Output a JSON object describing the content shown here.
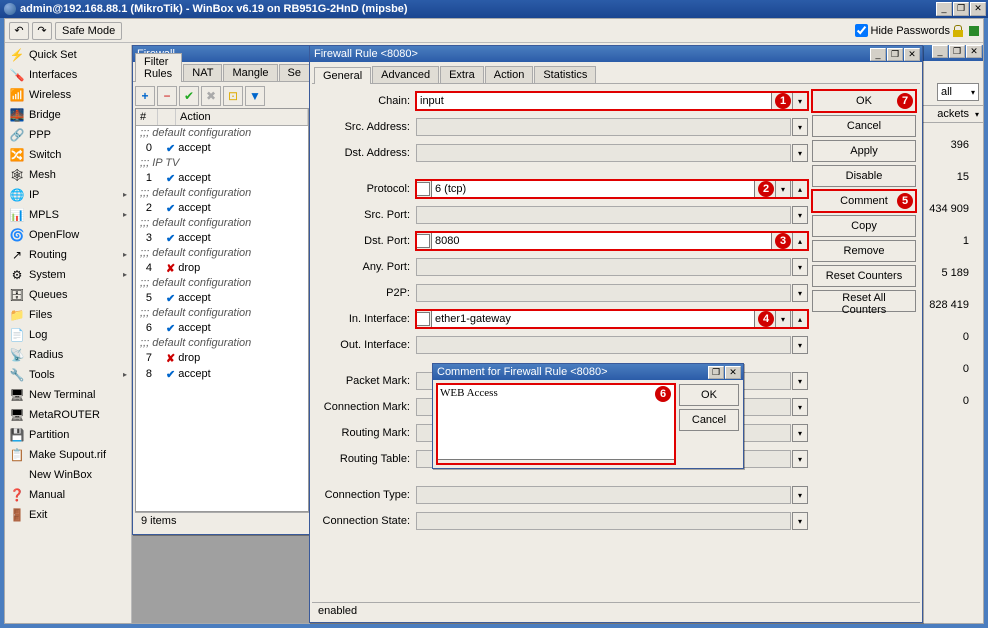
{
  "titlebar": "admin@192.168.88.1 (MikroTik) - WinBox v6.19 on RB951G-2HnD (mipsbe)",
  "toolbar": {
    "safe_mode": "Safe Mode",
    "hide_pw": "Hide Passwords"
  },
  "nav": [
    {
      "icon": "⚡",
      "label": "Quick Set"
    },
    {
      "icon": "🪛",
      "label": "Interfaces"
    },
    {
      "icon": "📶",
      "label": "Wireless"
    },
    {
      "icon": "🌉",
      "label": "Bridge"
    },
    {
      "icon": "🔗",
      "label": "PPP"
    },
    {
      "icon": "🔀",
      "label": "Switch"
    },
    {
      "icon": "🕸",
      "label": "Mesh"
    },
    {
      "icon": "🌐",
      "label": "IP",
      "arrow": true
    },
    {
      "icon": "📊",
      "label": "MPLS",
      "arrow": true
    },
    {
      "icon": "🌀",
      "label": "OpenFlow"
    },
    {
      "icon": "↗",
      "label": "Routing",
      "arrow": true
    },
    {
      "icon": "⚙",
      "label": "System",
      "arrow": true
    },
    {
      "icon": "🗄",
      "label": "Queues"
    },
    {
      "icon": "📁",
      "label": "Files"
    },
    {
      "icon": "📄",
      "label": "Log"
    },
    {
      "icon": "📡",
      "label": "Radius"
    },
    {
      "icon": "🔧",
      "label": "Tools",
      "arrow": true
    },
    {
      "icon": "🖥",
      "label": "New Terminal"
    },
    {
      "icon": "🖥",
      "label": "MetaROUTER"
    },
    {
      "icon": "💾",
      "label": "Partition"
    },
    {
      "icon": "📋",
      "label": "Make Supout.rif"
    },
    {
      "icon": "",
      "label": "New WinBox"
    },
    {
      "icon": "❓",
      "label": "Manual"
    },
    {
      "icon": "🚪",
      "label": "Exit"
    }
  ],
  "firewall": {
    "title": "Firewall",
    "tabs": [
      "Filter Rules",
      "NAT",
      "Mangle",
      "Se"
    ],
    "grid_headers": [
      "#",
      "",
      "Action"
    ],
    "groups": [
      {
        "comment": ";;; default configuration",
        "rows": [
          {
            "n": "0",
            "action": "accept",
            "icon": "check"
          }
        ]
      },
      {
        "comment": ";;; IP TV",
        "rows": [
          {
            "n": "1",
            "action": "accept",
            "icon": "check"
          }
        ]
      },
      {
        "comment": ";;; default configuration",
        "rows": [
          {
            "n": "2",
            "action": "accept",
            "icon": "check"
          }
        ]
      },
      {
        "comment": ";;; default configuration",
        "rows": [
          {
            "n": "3",
            "action": "accept",
            "icon": "check"
          }
        ]
      },
      {
        "comment": ";;; default configuration",
        "rows": [
          {
            "n": "4",
            "action": "drop",
            "icon": "x"
          }
        ]
      },
      {
        "comment": ";;; default configuration",
        "rows": [
          {
            "n": "5",
            "action": "accept",
            "icon": "check"
          }
        ]
      },
      {
        "comment": ";;; default configuration",
        "rows": [
          {
            "n": "6",
            "action": "accept",
            "icon": "check"
          }
        ]
      },
      {
        "comment": ";;; default configuration",
        "rows": [
          {
            "n": "7",
            "action": "drop",
            "icon": "x"
          }
        ]
      },
      {
        "comment": "",
        "rows": [
          {
            "n": "8",
            "action": "accept",
            "icon": "check"
          }
        ]
      }
    ],
    "status": "9 items"
  },
  "rule": {
    "title": "Firewall Rule <8080>",
    "tabs": [
      "General",
      "Advanced",
      "Extra",
      "Action",
      "Statistics"
    ],
    "labels": {
      "chain": "Chain:",
      "src_addr": "Src. Address:",
      "dst_addr": "Dst. Address:",
      "protocol": "Protocol:",
      "src_port": "Src. Port:",
      "dst_port": "Dst. Port:",
      "any_port": "Any. Port:",
      "p2p": "P2P:",
      "in_if": "In. Interface:",
      "out_if": "Out. Interface:",
      "pkt_mark": "Packet Mark:",
      "conn_mark": "Connection Mark:",
      "route_mark": "Routing Mark:",
      "route_table": "Routing Table:",
      "conn_type": "Connection Type:",
      "conn_state": "Connection State:"
    },
    "values": {
      "chain": "input",
      "protocol": "6 (tcp)",
      "dst_port": "8080",
      "in_if": "ether1-gateway"
    },
    "buttons": {
      "ok": "OK",
      "cancel": "Cancel",
      "apply": "Apply",
      "disable": "Disable",
      "comment": "Comment",
      "copy": "Copy",
      "remove": "Remove",
      "reset_counters": "Reset Counters",
      "reset_all": "Reset All Counters"
    },
    "status": "enabled"
  },
  "comment_dlg": {
    "title": "Comment for Firewall Rule <8080>",
    "value": "WEB Access",
    "ok": "OK",
    "cancel": "Cancel"
  },
  "right_panel": {
    "header1": "all",
    "header2": "ackets",
    "rows": [
      "396",
      "15",
      "434 909",
      "1",
      "5 189",
      "828 419",
      "0",
      "0",
      "0"
    ]
  },
  "badges": {
    "1": "1",
    "2": "2",
    "3": "3",
    "4": "4",
    "5": "5",
    "6": "6",
    "7": "7"
  }
}
